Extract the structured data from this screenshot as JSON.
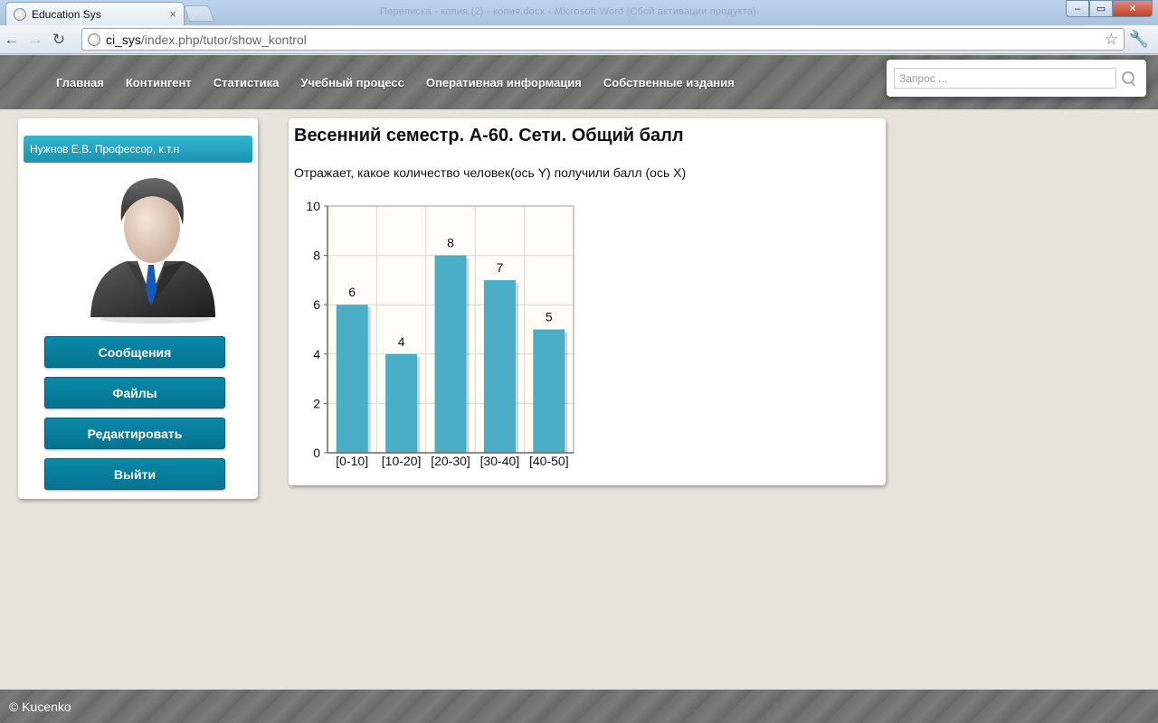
{
  "browser": {
    "tab_title": "Education Sys",
    "tab_close": "×",
    "window_title": "Переписка - копия (2) - копия.docx - Microsoft Word (Сбой активации продукта)",
    "url_host": "ci_sys",
    "url_path": "/index.php/tutor/show_kontrol",
    "back": "←",
    "forward": "→",
    "reload": "↻",
    "star": "☆",
    "wrench": "🔧",
    "min": "–",
    "max": "▭",
    "close": "✕"
  },
  "menu": [
    {
      "label": "Главная"
    },
    {
      "label": "Контингент"
    },
    {
      "label": "Статистика"
    },
    {
      "label": "Учебный процесс"
    },
    {
      "label": "Оперативная информация"
    },
    {
      "label": "Собственные издания"
    }
  ],
  "search": {
    "placeholder": "Запрос ..."
  },
  "sidebar": {
    "user": "Нужнов Е.В. Профессор, к.т.н",
    "buttons": [
      {
        "label": "Сообщения"
      },
      {
        "label": "Файлы"
      },
      {
        "label": "Редактировать"
      },
      {
        "label": "Выйти"
      }
    ]
  },
  "main": {
    "title": "Весенний семестр. А-60. Сети. Общий балл",
    "description": "Отражает, какое количество человек(ось Y) получили балл (ось X)"
  },
  "chart_data": {
    "type": "bar",
    "categories": [
      "[0-10]",
      "[10-20]",
      "[20-30]",
      "[30-40]",
      "[40-50]"
    ],
    "values": [
      6,
      4,
      8,
      7,
      5
    ],
    "ylim": [
      0,
      10
    ],
    "yticks": [
      0,
      2,
      4,
      6,
      8,
      10
    ],
    "grid": true,
    "bar_color": "#4aafc6",
    "plot_background": "#fdfcf6"
  },
  "footer": {
    "copyright": "© Kucenko"
  }
}
